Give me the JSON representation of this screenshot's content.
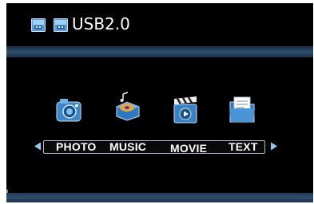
{
  "header": {
    "title": "USB2.0",
    "icons": [
      "usb-device-icon",
      "usb-device-icon"
    ]
  },
  "menu": {
    "items": [
      {
        "label": "PHOTO",
        "icon": "camera-icon"
      },
      {
        "label": "MUSIC",
        "icon": "music-disc-icon"
      },
      {
        "label": "MOVIE",
        "icon": "clapperboard-icon"
      },
      {
        "label": "TEXT",
        "icon": "document-folder-icon"
      }
    ],
    "left_arrow": "arrow-left-icon",
    "right_arrow": "arrow-right-icon"
  },
  "colors": {
    "background": "#000000",
    "band": "#2f4e6d",
    "text": "#ffffff",
    "icon_blue": "#4a8fd0"
  }
}
